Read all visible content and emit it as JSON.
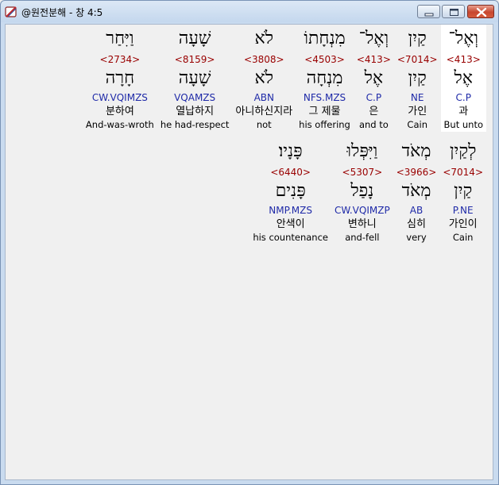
{
  "window": {
    "title": "@원전분해 - 창 4:5",
    "icons": {
      "app": "pen-scroll-icon",
      "minimize": "minimize-icon",
      "maximize": "maximize-icon",
      "close": "close-icon"
    }
  },
  "colors": {
    "strong_number": "#990000",
    "parsing": "#1f2aa8",
    "selected_bg": "#ffffff"
  },
  "rows": [
    [
      {
        "hebrew": "וְאֶל־",
        "strong": "<413>",
        "lexeme": "אֶל",
        "parsing": "C.P",
        "korean": "과",
        "english": "But unto"
      },
      {
        "hebrew": "קַיִן",
        "strong": "<7014>",
        "lexeme": "קַיִן",
        "parsing": "NE",
        "korean": "가인",
        "english": "Cain"
      },
      {
        "hebrew": "וְאֶל־",
        "strong": "<413>",
        "lexeme": "אֶל",
        "parsing": "C.P",
        "korean": "은",
        "english": "and to"
      },
      {
        "hebrew": "מִנְחָתוֹ",
        "strong": "<4503>",
        "lexeme": "מִנְחָה",
        "parsing": "NFS.MZS",
        "korean": "그 제물",
        "english": "his offering"
      },
      {
        "hebrew": "לֹא",
        "strong": "<3808>",
        "lexeme": "לֹא",
        "parsing": "ABN",
        "korean": "아니하신지라",
        "english": "not"
      },
      {
        "hebrew": "שָׁעָה",
        "strong": "<8159>",
        "lexeme": "שָׁעָה",
        "parsing": "VQAMZS",
        "korean": "열납하지",
        "english": "he had-respect"
      },
      {
        "hebrew": "וַיִּחַר",
        "strong": "<2734>",
        "lexeme": "חָרָה",
        "parsing": "CW.VQIMZS",
        "korean": "분하여",
        "english": "And-was-wroth"
      }
    ],
    [
      {
        "hebrew": "לְקַיִן",
        "strong": "<7014>",
        "lexeme": "קַיִן",
        "parsing": "P.NE",
        "korean": "가인이",
        "english": "Cain"
      },
      {
        "hebrew": "מְאֹד",
        "strong": "<3966>",
        "lexeme": "מְאֹד",
        "parsing": "AB",
        "korean": "심히",
        "english": "very"
      },
      {
        "hebrew": "וַיִּפְּלוּ",
        "strong": "<5307>",
        "lexeme": "נָפַל",
        "parsing": "CW.VQIMZP",
        "korean": "변하니",
        "english": "and-fell"
      },
      {
        "hebrew": "פָּנָיו׃",
        "strong": "<6440>",
        "lexeme": "פָּנִים",
        "parsing": "NMP.MZS",
        "korean": "안색이",
        "english": "his countenance"
      }
    ]
  ]
}
